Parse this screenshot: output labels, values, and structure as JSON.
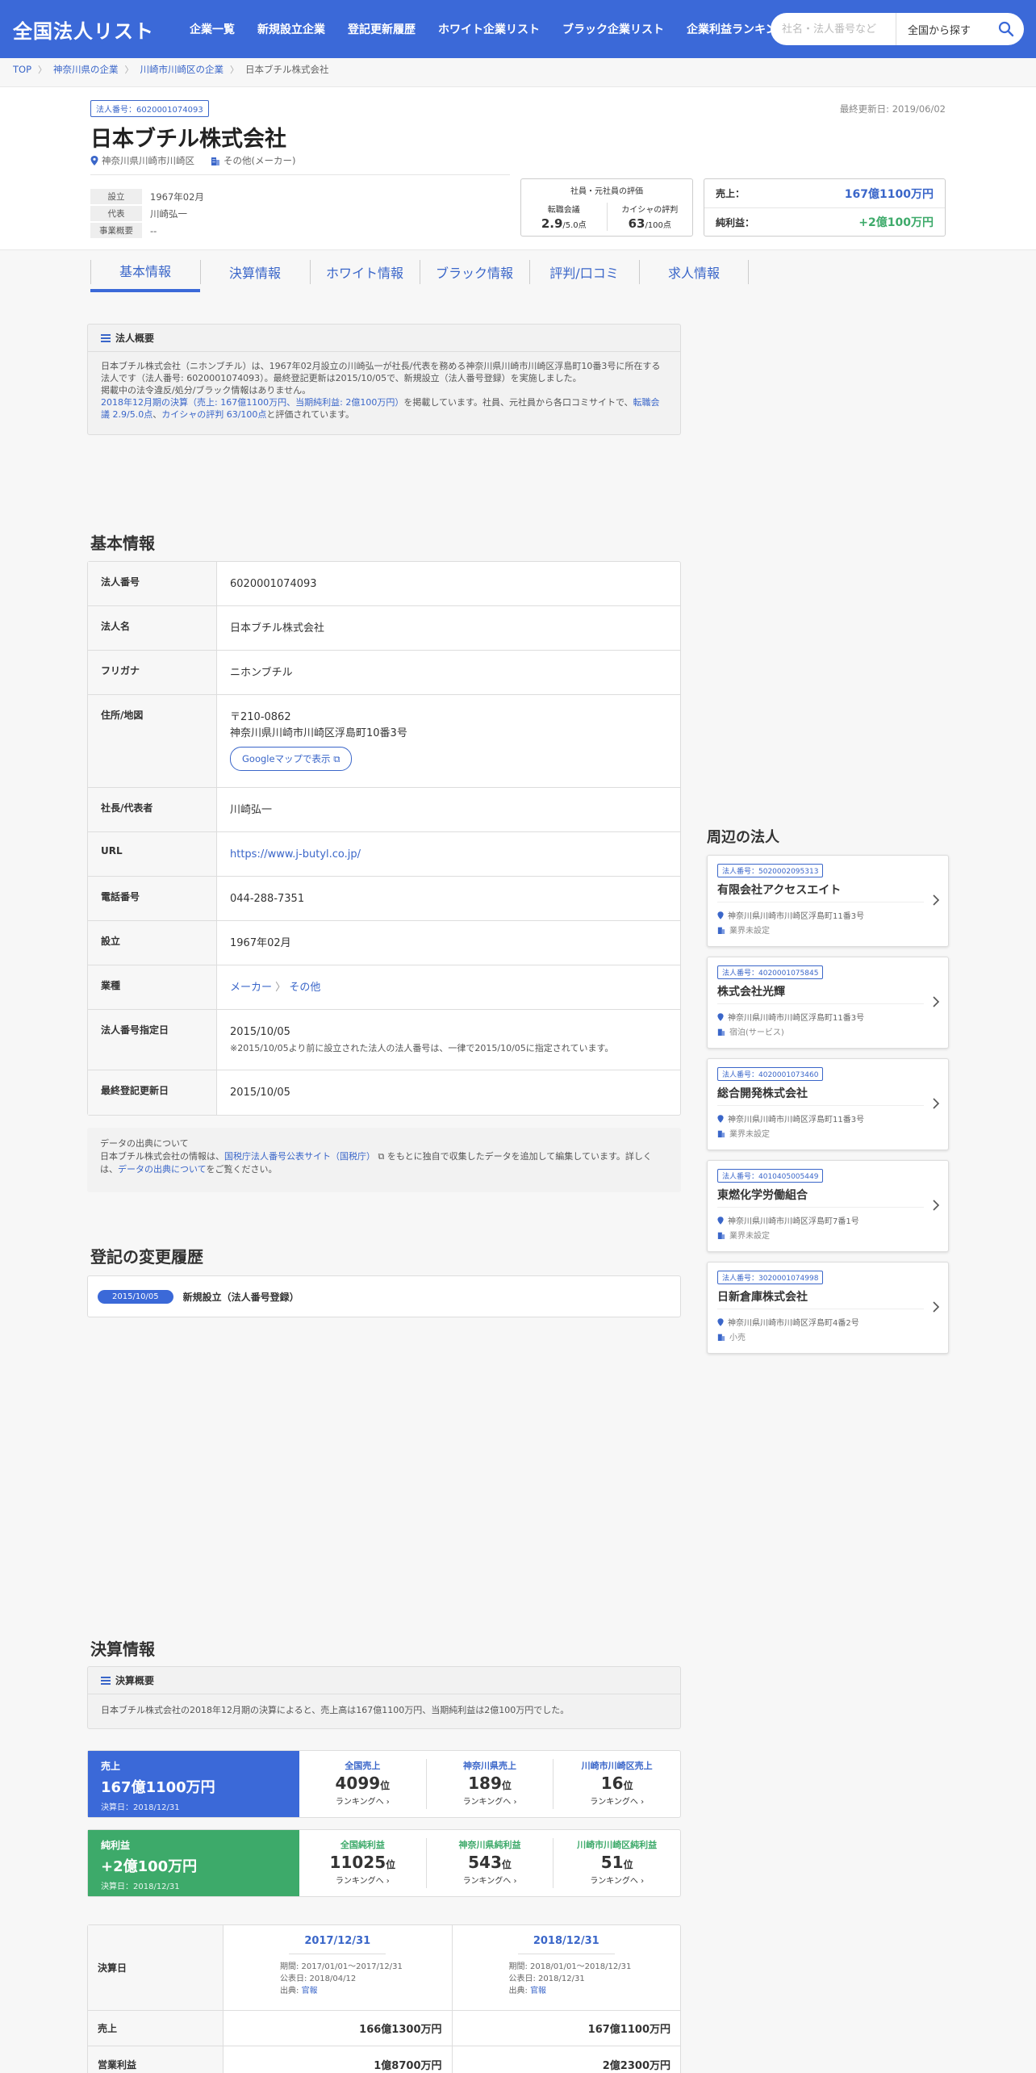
{
  "header": {
    "logo": "全国法人リスト",
    "nav": [
      "企業一覧",
      "新規設立企業",
      "登記更新履歴",
      "ホワイト企業リスト",
      "ブラック企業リスト",
      "企業利益ランキング"
    ],
    "search_placeholder": "社名・法人番号など",
    "search_area": "全国から探す"
  },
  "breadcrumb": [
    "TOP",
    "神奈川県の企業",
    "川崎市川崎区の企業",
    "日本ブチル株式会社"
  ],
  "company": {
    "number_badge": "法人番号：6020001074093",
    "updated": "最終更新日: 2019/06/02",
    "name": "日本ブチル株式会社",
    "location": "神奈川県川崎市川崎区",
    "industry": "その他(メーカー)",
    "est_label": "設立",
    "est_value": "1967年02月",
    "rep_label": "代表",
    "rep_value": "川崎弘一",
    "biz_label": "事業概要",
    "biz_value": "--"
  },
  "evaluation": {
    "title": "社員・元社員の評価",
    "col1_label": "転職会議",
    "col1_value": "2.9",
    "col1_unit": "/5.0点",
    "col2_label": "カイシャの評判",
    "col2_value": "63",
    "col2_unit": "/100点"
  },
  "sales_box": {
    "sales_label": "売上：",
    "sales_value": "167億1100万円",
    "profit_label": "純利益：",
    "profit_value": "+2億100万円"
  },
  "tabs": [
    "基本情報",
    "決算情報",
    "ホワイト情報",
    "ブラック情報",
    "評判/口コミ",
    "求人情報"
  ],
  "overview": {
    "title": "法人概要",
    "text1": "日本ブチル株式会社（ニホンブチル）は、1967年02月設立の川崎弘一が社長/代表を務める神奈川県川崎市川崎区浮島町10番3号に所在する法人です（法人番号: 6020001074093）。最終登記更新は2015/10/05で、新規設立（法人番号登録）を実施しました。",
    "text2": "掲載中の法令違反/処分/ブラック情報はありません。",
    "text3a": "2018年12月期の決算（売上: 167億1100万円、当期純利益: 2億100万円）",
    "text3b": "を掲載しています。社員、元社員から各口コミサイトで、",
    "text3c": "転職会議 2.9/5.0点",
    "text3d": "、",
    "text3e": "カイシャの評判 63/100点",
    "text3f": "と評価されています。"
  },
  "basic": {
    "heading": "基本情報",
    "rows": [
      {
        "k": "法人番号",
        "v": "6020001074093"
      },
      {
        "k": "法人名",
        "v": "日本ブチル株式会社"
      },
      {
        "k": "フリガナ",
        "v": "ニホンブチル"
      },
      {
        "k": "住所/地図",
        "zip": "〒210-0862",
        "addr": "神奈川県川崎市川崎区浮島町10番3号",
        "btn": "Googleマップで表示"
      },
      {
        "k": "社長/代表者",
        "v": "川崎弘一"
      },
      {
        "k": "URL",
        "v": "https://www.j-butyl.co.jp/"
      },
      {
        "k": "電話番号",
        "v": "044-288-7351"
      },
      {
        "k": "設立",
        "v": "1967年02月"
      },
      {
        "k": "業種",
        "v1": "メーカー",
        "v2": "その他"
      },
      {
        "k": "法人番号指定日",
        "v": "2015/10/05",
        "note": "※2015/10/05より前に設立された法人の法人番号は、一律で2015/10/05に指定されています。"
      },
      {
        "k": "最終登記更新日",
        "v": "2015/10/05"
      }
    ]
  },
  "source": {
    "title": "データの出典について",
    "t1": "日本ブチル株式会社の情報は、",
    "link1": "国税庁法人番号公表サイト（国税庁）",
    "t2": "をもとに独自で収集したデータを追加して編集しています。詳しく",
    "t3": "は、",
    "link2": "データの出典について",
    "t4": "をご覧ください。"
  },
  "history": {
    "heading": "登記の変更履歴",
    "date": "2015/10/05",
    "text": "新規設立（法人番号登録）"
  },
  "nearby": {
    "heading": "周辺の法人",
    "items": [
      {
        "num": "法人番号：5020002095313",
        "name": "有限会社アクセスエイト",
        "addr": "神奈川県川崎市川崎区浮島町11番3号",
        "ind": "業界未設定"
      },
      {
        "num": "法人番号：4020001075845",
        "name": "株式会社光輝",
        "addr": "神奈川県川崎市川崎区浮島町11番3号",
        "ind": "宿泊(サービス)"
      },
      {
        "num": "法人番号：4020001073460",
        "name": "総合開発株式会社",
        "addr": "神奈川県川崎市川崎区浮島町11番3号",
        "ind": "業界未設定"
      },
      {
        "num": "法人番号：4010405005449",
        "name": "東燃化学労働組合",
        "addr": "神奈川県川崎市川崎区浮島町7番1号",
        "ind": "業界未設定"
      },
      {
        "num": "法人番号：3020001074998",
        "name": "日新倉庫株式会社",
        "addr": "神奈川県川崎市川崎区浮島町4番2号",
        "ind": "小売"
      }
    ]
  },
  "finance": {
    "heading": "決算情報",
    "summary_title": "決算概要",
    "summary_text": "日本ブチル株式会社の2018年12月期の決算によると、売上高は167億1100万円、当期純利益は2億100万円でした。",
    "sales": {
      "label": "売上",
      "value": "167億1100万円",
      "date": "決算日：2018/12/31",
      "ranks": [
        {
          "label": "全国売上",
          "value": "4099",
          "unit": "位",
          "link": "ランキングへ"
        },
        {
          "label": "神奈川県売上",
          "value": "189",
          "unit": "位",
          "link": "ランキングへ"
        },
        {
          "label": "川崎市川崎区売上",
          "value": "16",
          "unit": "位",
          "link": "ランキングへ"
        }
      ]
    },
    "profit": {
      "label": "純利益",
      "value": "+2億100万円",
      "date": "決算日：2018/12/31",
      "ranks": [
        {
          "label": "全国純利益",
          "value": "11025",
          "unit": "位",
          "link": "ランキングへ"
        },
        {
          "label": "神奈川県純利益",
          "value": "543",
          "unit": "位",
          "link": "ランキングへ"
        },
        {
          "label": "川崎市川崎区純利益",
          "value": "51",
          "unit": "位",
          "link": "ランキングへ"
        }
      ]
    },
    "table": {
      "row_label": "決算日",
      "cols": [
        {
          "date": "2017/12/31",
          "period": "期間: 2017/01/01〜2017/12/31",
          "pub": "公表日: 2018/04/12",
          "src_label": "出典: ",
          "src": "官報"
        },
        {
          "date": "2018/12/31",
          "period": "期間: 2018/01/01〜2018/12/31",
          "pub": "公表日: 2018/12/31",
          "src_label": "出典: ",
          "src": "官報"
        }
      ],
      "sales_label": "売上",
      "sales": [
        "166億1300万円",
        "167億1100万円"
      ],
      "op_label": "営業利益",
      "op": [
        "1億8700万円",
        "2億2300万円"
      ]
    }
  },
  "colors": {
    "primary": "#3b69d8",
    "green": "#3daa6a",
    "link": "#3a66c9"
  }
}
